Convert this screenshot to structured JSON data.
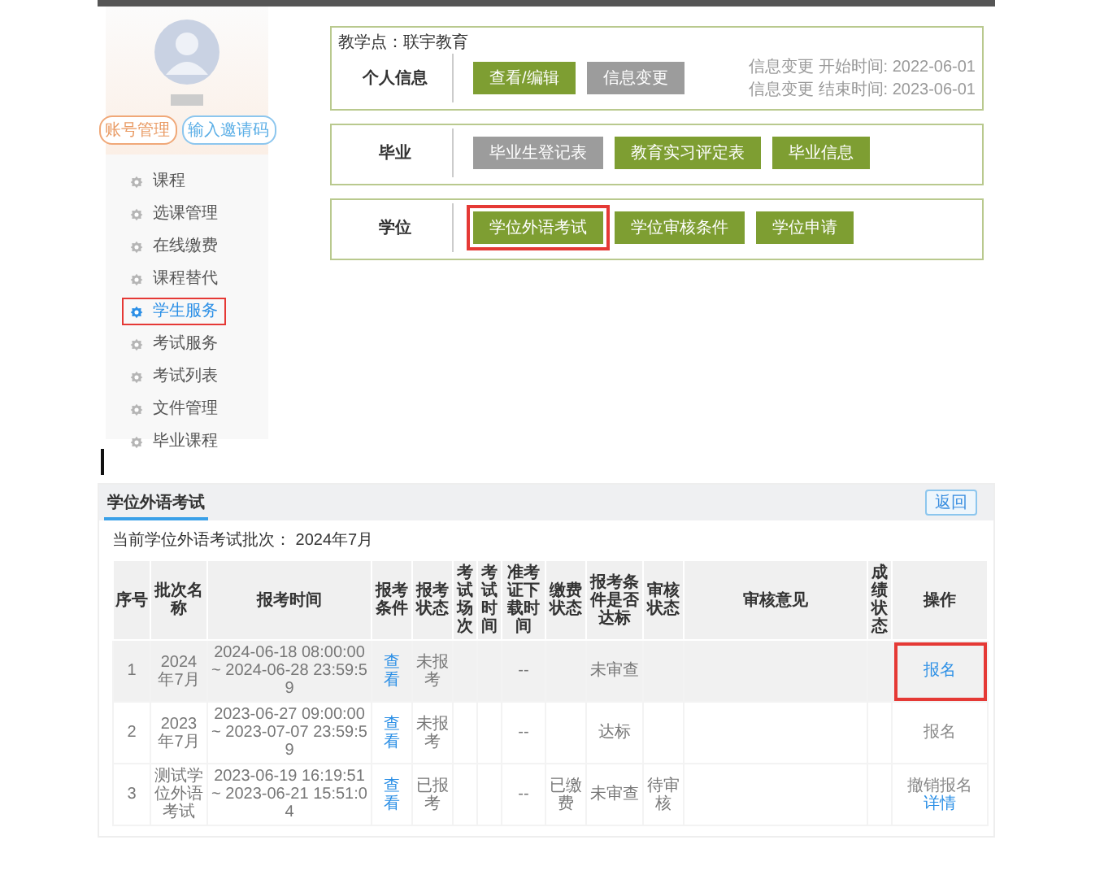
{
  "sidebar": {
    "account_buttons": [
      {
        "label": "账号管理",
        "kind": "orange"
      },
      {
        "label": "输入邀请码",
        "kind": "blue"
      }
    ],
    "items": [
      {
        "label": "课程",
        "selected": false,
        "highlighted": false
      },
      {
        "label": "选课管理",
        "selected": false,
        "highlighted": false
      },
      {
        "label": "在线缴费",
        "selected": false,
        "highlighted": false
      },
      {
        "label": "课程替代",
        "selected": false,
        "highlighted": false
      },
      {
        "label": "学生服务",
        "selected": true,
        "highlighted": true
      },
      {
        "label": "考试服务",
        "selected": false,
        "highlighted": false
      },
      {
        "label": "考试列表",
        "selected": false,
        "highlighted": false
      },
      {
        "label": "文件管理",
        "selected": false,
        "highlighted": false
      },
      {
        "label": "毕业课程",
        "selected": false,
        "highlighted": false
      }
    ]
  },
  "teaching_point": "教学点：联宇教育",
  "sections": [
    {
      "label": "个人信息",
      "buttons": [
        {
          "label": "查看/编辑",
          "disabled": false,
          "highlighted": false
        },
        {
          "label": "信息变更",
          "disabled": true,
          "highlighted": false
        }
      ],
      "notes": [
        "信息变更 开始时间: 2022-06-01",
        "信息变更 结束时间: 2023-06-01"
      ]
    },
    {
      "label": "毕业",
      "buttons": [
        {
          "label": "毕业生登记表",
          "disabled": true,
          "highlighted": false
        },
        {
          "label": "教育实习评定表",
          "disabled": false,
          "highlighted": false
        },
        {
          "label": "毕业信息",
          "disabled": false,
          "highlighted": false
        }
      ]
    },
    {
      "label": "学位",
      "buttons": [
        {
          "label": "学位外语考试",
          "disabled": false,
          "highlighted": true
        },
        {
          "label": "学位审核条件",
          "disabled": false,
          "highlighted": false
        },
        {
          "label": "学位申请",
          "disabled": false,
          "highlighted": false
        }
      ]
    }
  ],
  "exam_panel": {
    "title": "学位外语考试",
    "back_button": "返回",
    "current_batch": "当前学位外语考试批次： 2024年7月",
    "table": {
      "columns": [
        "序号",
        "批次名称",
        "报考时间",
        "报考条件",
        "报考状态",
        "考试场次",
        "考试时间",
        "准考证下载时间",
        "缴费状态",
        "报考条件是否达标",
        "审核状态",
        "审核意见",
        "成绩状态",
        "操作"
      ],
      "rows": [
        {
          "selected": true,
          "cells": [
            {
              "kind": "text",
              "text": "1"
            },
            {
              "kind": "text",
              "text": "2024年7月"
            },
            {
              "kind": "text",
              "text": "2024-06-18 08:00:00~ 2024-06-28 23:59:59"
            },
            {
              "kind": "link",
              "text": "查看"
            },
            {
              "kind": "text",
              "text": "未报考"
            },
            {
              "kind": "empty"
            },
            {
              "kind": "empty"
            },
            {
              "kind": "text",
              "text": "--"
            },
            {
              "kind": "empty"
            },
            {
              "kind": "text",
              "text": "未审查"
            },
            {
              "kind": "empty"
            },
            {
              "kind": "empty"
            },
            {
              "kind": "empty"
            },
            {
              "kind": "actions",
              "actions": [
                {
                  "label": "报名",
                  "disabled": false,
                  "highlighted": true
                }
              ]
            }
          ]
        },
        {
          "selected": false,
          "cells": [
            {
              "kind": "text",
              "text": "2"
            },
            {
              "kind": "text",
              "text": "2023年7月"
            },
            {
              "kind": "text",
              "text": "2023-06-27 09:00:00~ 2023-07-07 23:59:59"
            },
            {
              "kind": "link",
              "text": "查看"
            },
            {
              "kind": "text",
              "text": "未报考"
            },
            {
              "kind": "empty"
            },
            {
              "kind": "empty"
            },
            {
              "kind": "text",
              "text": "--"
            },
            {
              "kind": "empty"
            },
            {
              "kind": "text",
              "text": "达标"
            },
            {
              "kind": "empty"
            },
            {
              "kind": "empty"
            },
            {
              "kind": "empty"
            },
            {
              "kind": "actions",
              "actions": [
                {
                  "label": "报名",
                  "disabled": true,
                  "highlighted": false
                }
              ]
            }
          ]
        },
        {
          "selected": false,
          "cells": [
            {
              "kind": "text",
              "text": "3"
            },
            {
              "kind": "text",
              "text": "测试学位外语考试"
            },
            {
              "kind": "text",
              "text": "2023-06-19 16:19:51~ 2023-06-21 15:51:04"
            },
            {
              "kind": "link",
              "text": "查看"
            },
            {
              "kind": "text",
              "text": "已报考"
            },
            {
              "kind": "empty"
            },
            {
              "kind": "empty"
            },
            {
              "kind": "text",
              "text": "--"
            },
            {
              "kind": "text",
              "text": "已缴费"
            },
            {
              "kind": "text",
              "text": "未审查"
            },
            {
              "kind": "text",
              "text": "待审核"
            },
            {
              "kind": "empty"
            },
            {
              "kind": "empty"
            },
            {
              "kind": "actions",
              "actions": [
                {
                  "label": "撤销报名",
                  "disabled": true,
                  "highlighted": false
                },
                {
                  "label": "详情",
                  "disabled": false,
                  "highlighted": false
                }
              ]
            }
          ]
        }
      ]
    }
  }
}
